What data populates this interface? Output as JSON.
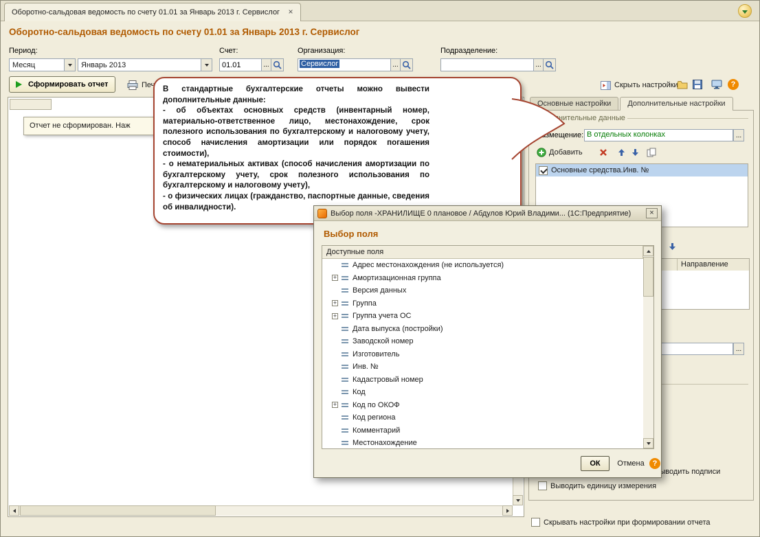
{
  "glyphs": {
    "close": "×",
    "help": "?",
    "dots": "...",
    "plus": "+"
  },
  "tab_bar": {
    "tab_title": "Оборотно-сальдовая ведомость по счету 01.01 за Январь 2013 г. Сервислог"
  },
  "header": {
    "title": "Оборотно-сальдовая ведомость по счету 01.01 за Январь 2013 г. Сервислог"
  },
  "filters": {
    "period": {
      "label": "Период:",
      "mode": "Месяц",
      "value": "Январь 2013"
    },
    "account": {
      "label": "Счет:",
      "value": "01.01"
    },
    "organization": {
      "label": "Организация:",
      "value": "Сервислог"
    },
    "department": {
      "label": "Подразделение:",
      "value": ""
    }
  },
  "toolbar": {
    "generate_label": "Сформировать отчет",
    "print_label": "Печать",
    "hide_settings_label": "Скрыть настройки"
  },
  "report": {
    "empty_message": "Отчет не сформирован. Наж"
  },
  "callout": {
    "paragraphs": [
      "В стандартные бухгалтерские отчеты  можно  вывести дополнительные данные:",
      "- об объектах основных средств (инвентарный номер, материально-ответственное лицо, местонахождение, срок полезного использования по бухгалтерскому и налоговому учету, способ начисления амортизации или порядок погашения стоимости),",
      "- о нематериальных активах (способ начисления амортизации по бухгалтерскому учету, срок полезного использования по бухгалтерскому и налоговому учету),",
      "- о физических лицах (гражданство, паспортные данные, сведения об инвалидности)."
    ]
  },
  "settings": {
    "tabs": [
      {
        "label": "Основные настройки"
      },
      {
        "label": "Дополнительные настройки"
      }
    ],
    "group_title": "Дополнительные данные",
    "placement_label": "Размещение:",
    "placement_value": "В отдельных колонках",
    "add_label": "Добавить",
    "fields": [
      {
        "label": "Основные средства.Инв. №",
        "checked": true
      }
    ],
    "direction_header": "Направление",
    "signatures_checkbox_label": "Выводить подписи",
    "unit_checkbox_label": "Выводить единицу измерения",
    "hide_when_generate_label": "Скрывать настройки при формировании отчета"
  },
  "dialog": {
    "titlebar_text": "Выбор поля -ХРАНИЛИЩЕ  0 плановое / Абдулов Юрий Владими... (1С:Предприятие)",
    "heading": "Выбор поля",
    "list_header": "Доступные поля",
    "items": [
      {
        "label": "Адрес местонахождения (не используется)",
        "expandable": false
      },
      {
        "label": "Амортизационная группа",
        "expandable": true
      },
      {
        "label": "Версия данных",
        "expandable": false
      },
      {
        "label": "Группа",
        "expandable": true
      },
      {
        "label": "Группа учета ОС",
        "expandable": true
      },
      {
        "label": "Дата выпуска (постройки)",
        "expandable": false
      },
      {
        "label": "Заводской номер",
        "expandable": false
      },
      {
        "label": "Изготовитель",
        "expandable": false
      },
      {
        "label": "Инв. №",
        "expandable": false
      },
      {
        "label": "Кадастровый номер",
        "expandable": false
      },
      {
        "label": "Код",
        "expandable": false
      },
      {
        "label": "Код по ОКОФ",
        "expandable": true
      },
      {
        "label": "Код региона",
        "expandable": false
      },
      {
        "label": "Комментарий",
        "expandable": false
      },
      {
        "label": "Местонахождение",
        "expandable": false
      }
    ],
    "ok_label": "ОК",
    "cancel_label": "Отмена"
  },
  "colors": {
    "accent_title": "#B05A00",
    "bubble_border": "#A54430",
    "selection_blue": "#2E5FA3",
    "value_green": "#007A00"
  }
}
